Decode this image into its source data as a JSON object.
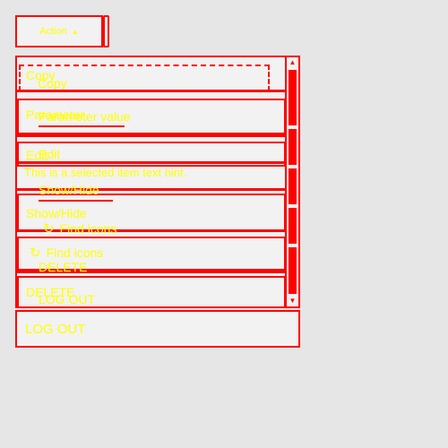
{
  "action_button": {
    "label": "Action",
    "caret_icon": "caret-up-icon"
  },
  "menu": {
    "items": {
      "copy": "Copy",
      "parameter": "Parameter",
      "edit": "Edit",
      "show_hide": "Show/Hide",
      "find_icons": "Find icons",
      "delete": "DELETE"
    },
    "ghost": {
      "copy": "Copy",
      "parameter_value": "Parameter value",
      "edit": "Edit",
      "selected_note": "This is a selected item text hint.",
      "show_hide": "Show/Hide",
      "find_icons": "Find icons",
      "delete": "DELETE",
      "logout": "LOG OUT"
    }
  },
  "logout_label": "LOG OUT",
  "colors": {
    "outline": "#ff0000",
    "text": "#ffff00",
    "background": "#e6e6e6",
    "surface": "#f2f2f2"
  }
}
